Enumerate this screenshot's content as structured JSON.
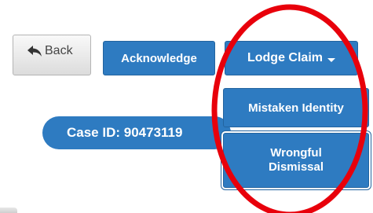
{
  "toolbar": {
    "back_label": "Back",
    "back_icon": "reply-arrow-icon",
    "acknowledge_label": "Acknowledge",
    "lodge_claim_label": "Lodge Claim"
  },
  "dropdown": {
    "items": [
      {
        "label": "Mistaken Identity"
      },
      {
        "label": "Wrongful\nDismissal"
      }
    ]
  },
  "case": {
    "label": "Case ID: 90473119"
  },
  "colors": {
    "primary": "#2e7bc1",
    "highlight_ring": "#e8000b"
  }
}
